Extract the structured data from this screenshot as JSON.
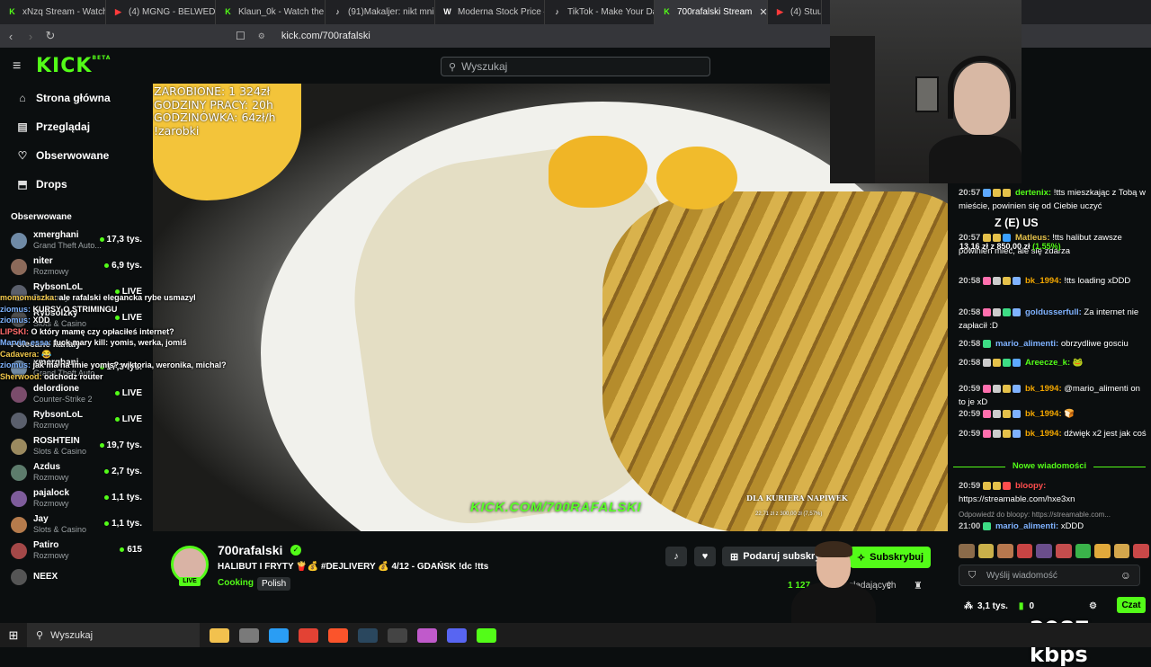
{
  "browser": {
    "tabs": [
      {
        "label": "xNzq Stream - Watch Live",
        "color": "#53fc18",
        "glyph": "K"
      },
      {
        "label": "(4) MGNG - BELWEDER (o",
        "color": "#ff3b3b",
        "glyph": "▶"
      },
      {
        "label": "Klaun_0k - Watch the VOD",
        "color": "#53fc18",
        "glyph": "K"
      },
      {
        "label": "(91)Makaljer: nikt mnie ni",
        "color": "#ffffff",
        "glyph": "♪"
      },
      {
        "label": "Moderna Stock Price — M",
        "color": "#ffffff",
        "glyph": "W"
      },
      {
        "label": "TikTok - Make Your Day",
        "color": "#ffffff",
        "glyph": "♪"
      },
      {
        "label": "700rafalski Stream",
        "color": "#53fc18",
        "glyph": "K",
        "active": true
      },
      {
        "label": "(4) Stuu",
        "color": "#ff3b3b",
        "glyph": "▶"
      }
    ],
    "url": "kick.com/700rafalski"
  },
  "header": {
    "logo": "KICK",
    "logo_badge": "BETA",
    "search_placeholder": "Wyszukaj"
  },
  "sidebar": {
    "nav": [
      {
        "label": "Strona główna",
        "icon": "home-icon",
        "glyph": "⌂"
      },
      {
        "label": "Przeglądaj",
        "icon": "browse-icon",
        "glyph": "▤"
      },
      {
        "label": "Obserwowane",
        "icon": "heart-icon",
        "glyph": "♡"
      },
      {
        "label": "Drops",
        "icon": "drops-icon",
        "glyph": "⬒"
      }
    ],
    "followed_title": "Obserwowane",
    "followed": [
      {
        "name": "xmerghani",
        "category": "Grand Theft Auto...",
        "viewers": "17,3 tys.",
        "avatar": "#6f8aa6"
      },
      {
        "name": "niter",
        "category": "Rozmowy",
        "viewers": "6,9 tys.",
        "avatar": "#8c6a5a"
      },
      {
        "name": "RybsonLoL",
        "category": "Rozmowy",
        "viewers": "LIVE",
        "avatar": "#5a5f6c"
      },
      {
        "name": "Rybsolzky",
        "category": "Slots & Casino",
        "viewers": "LIVE",
        "avatar": "#4e4e4e"
      }
    ],
    "recommended_title": "Polecane kanały",
    "recommended": [
      {
        "name": "xmerghani",
        "category": "Grand Theft Auto...",
        "viewers": "17,3 tys.",
        "avatar": "#6f8aa6"
      },
      {
        "name": "delordione",
        "category": "Counter-Strike 2",
        "viewers": "LIVE",
        "avatar": "#7a4c6b"
      },
      {
        "name": "RybsonLoL",
        "category": "Rozmowy",
        "viewers": "LIVE",
        "avatar": "#5a5f6c"
      },
      {
        "name": "ROSHTEIN",
        "category": "Slots & Casino",
        "viewers": "19,7 tys.",
        "avatar": "#9b8a5f"
      },
      {
        "name": "Azdus",
        "category": "Rozmowy",
        "viewers": "2,7 tys.",
        "avatar": "#5d7c6c"
      },
      {
        "name": "pajalock",
        "category": "Rozmowy",
        "viewers": "1,1 tys.",
        "avatar": "#7e5c9b"
      },
      {
        "name": "Jay",
        "category": "Slots & Casino",
        "viewers": "1,1 tys.",
        "avatar": "#b57b4c"
      },
      {
        "name": "Patiro",
        "category": "Rozmowy",
        "viewers": "615",
        "avatar": "#a44848"
      },
      {
        "name": "NEEX",
        "category": "",
        "viewers": "",
        "avatar": "#555555"
      }
    ]
  },
  "overlay_chat": [
    {
      "user": "momomuszka:",
      "text": "ale rafalski elegancka rybe usmazyl",
      "cls": "u3"
    },
    {
      "user": "ziomus:",
      "text": "KURSY O STRIMINGU",
      "cls": "u"
    },
    {
      "user": "ziomus:",
      "text": "XDD",
      "cls": "u"
    },
    {
      "user": "LIPSKI:",
      "text": "O który mamę czy opłaciłeś internet?",
      "cls": "u2"
    },
    {
      "user": "Marvin_essa:",
      "text": "fuck mary kill: yomis, werka, jomiś",
      "cls": "u"
    },
    {
      "user": "Cadavera:",
      "text": "😂",
      "cls": "u3"
    },
    {
      "user": "ziomus:",
      "text": "jak ma na imie yomis? wiktoria, weronika, michal?",
      "cls": "u"
    },
    {
      "user": "Sherwood:",
      "text": "odchodz router",
      "cls": "u3"
    }
  ],
  "video": {
    "earnings_lines": [
      "ZAROBIONE: 1 324zł",
      "GODZINY PRACY: 20h",
      "GODZINÓWKA: 64zł/h",
      "!zarobki"
    ],
    "watermark": "KICK.COM/700RAFALSKI",
    "tip_label": "DLA KURIERA NAPIWEK",
    "tip_value": "22,71 zł z 300,00 zł (7,57%)"
  },
  "goal_overlay": {
    "title": "Z (E) US",
    "progress": "13,16 zł z 850,00 zł",
    "percent": "(1.55%)"
  },
  "chat": {
    "messages": [
      {
        "time": "20:57",
        "user": "dertenix:",
        "user_color": "#53fc18",
        "text": "!tts mieszkając z Tobą w mieście, powinien się od Ciebie uczyć",
        "badges": [
          "#5da8ff",
          "#e5c14a",
          "#e5c14a"
        ]
      },
      {
        "time": "20:57",
        "user": "Matleus:",
        "user_color": "#e5c14a",
        "text": "!tts halibut zawsze powinien mieć, ale się zdarza",
        "badges": [
          "#e5c14a",
          "#e5c14a",
          "#3aa0ff"
        ]
      },
      {
        "time": "20:58",
        "user": "bk_1994:",
        "user_color": "#f2a600",
        "text": "!tts loading xDDD",
        "badges": [
          "#ff6fae",
          "#cccccc",
          "#e5c14a",
          "#7fb2ff"
        ]
      },
      {
        "time": "20:58",
        "user": "goldusserfull:",
        "user_color": "#7fb2ff",
        "text": "Za internet nie zapłacił :D",
        "badges": [
          "#ff6fae",
          "#cccccc",
          "#3ddc84",
          "#7fb2ff"
        ]
      },
      {
        "time": "20:58",
        "user": "mario_alimenti:",
        "user_color": "#7fb2ff",
        "text": "obrzydliwe gosciu",
        "badges": [
          "#3ddc84"
        ]
      },
      {
        "time": "20:58",
        "user": "Areecze_k:",
        "user_color": "#53fc18",
        "text": "🐸",
        "badges": [
          "#cccccc",
          "#e5c14a",
          "#3ddc84",
          "#5da8ff"
        ]
      },
      {
        "time": "20:59",
        "user": "bk_1994:",
        "user_color": "#f2a600",
        "text": "@mario_alimenti on to je xD",
        "badges": [
          "#ff6fae",
          "#cccccc",
          "#e5c14a",
          "#7fb2ff"
        ]
      },
      {
        "time": "20:59",
        "user": "bk_1994:",
        "user_color": "#f2a600",
        "text": "🍞",
        "badges": [
          "#ff6fae",
          "#cccccc",
          "#e5c14a",
          "#7fb2ff"
        ]
      },
      {
        "time": "20:59",
        "user": "bk_1994:",
        "user_color": "#f2a600",
        "text": "dźwięk x2 jest jak coś",
        "badges": [
          "#ff6fae",
          "#cccccc",
          "#e5c14a",
          "#7fb2ff"
        ]
      }
    ],
    "new_messages_label": "Nowe wiadomości",
    "new_messages": [
      {
        "time": "20:59",
        "user": "bloopy:",
        "user_color": "#ff4d4d",
        "text": "https://streamable.com/hxe3xn",
        "badges": [
          "#e5c14a",
          "#e5c14a",
          "#ff4d4d"
        ]
      },
      {
        "time": "",
        "user": "",
        "user_color": "#999999",
        "text": "Odpowiedź do bloopy: https://streamable.com...",
        "badges": []
      },
      {
        "time": "21:00",
        "user": "mario_alimenti:",
        "user_color": "#7fb2ff",
        "text": "xDDD",
        "badges": [
          "#3ddc84"
        ]
      }
    ],
    "input_placeholder": "Wyślij wiadomość",
    "followers_count": "3,1 tys.",
    "points": "0",
    "send_label": "Czat"
  },
  "stream_info": {
    "channel_name": "700rafalski",
    "live_label": "LIVE",
    "title": "HALIBUT I FRYTY 🍟💰 #DEJLIVERY 💰 4/12 - GDAŃSK !dc !tts",
    "category": "Cooking",
    "tag": "Polish",
    "gift_label": "Podaruj subskrypcje",
    "subscribe_label": "Subskrybuj",
    "viewers": "1 127",
    "viewers_label": "oglądających"
  },
  "bitrate": "2987 kbps",
  "taskbar": {
    "search_placeholder": "Wyszukaj",
    "apps": [
      {
        "name": "file-explorer-icon",
        "color": "#f2c14e"
      },
      {
        "name": "mail-icon",
        "color": "#7a7a7a"
      },
      {
        "name": "edge-icon",
        "color": "#2a9df4"
      },
      {
        "name": "chrome-icon",
        "color": "#e34234"
      },
      {
        "name": "brave-icon",
        "color": "#fb542b"
      },
      {
        "name": "steam-icon",
        "color": "#2a475e"
      },
      {
        "name": "obs-icon",
        "color": "#444444"
      },
      {
        "name": "app-icon",
        "color": "#c05acb"
      },
      {
        "name": "discord-icon",
        "color": "#5865f2"
      },
      {
        "name": "kick-icon",
        "color": "#53fc18"
      }
    ]
  }
}
